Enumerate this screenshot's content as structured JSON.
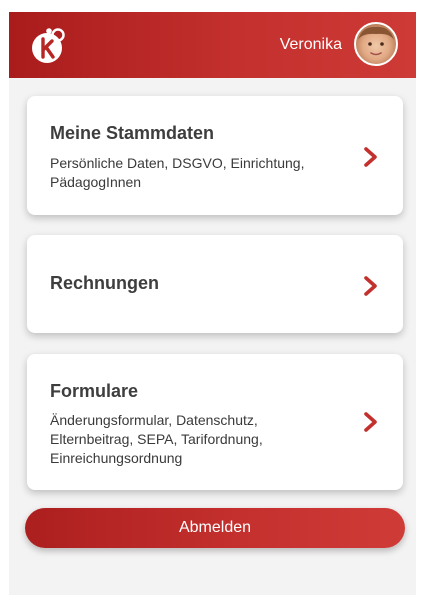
{
  "header": {
    "user_name": "Veronika",
    "logo_icon": "kita-logo-icon",
    "avatar_icon": "user-avatar",
    "colors": {
      "header_start": "#a91c1c",
      "header_end": "#ce3a36"
    }
  },
  "cards": [
    {
      "title": "Meine Stammdaten",
      "subtitle": "Persönliche Daten, DSGVO, Einrichtung, PädagogInnen",
      "icon": "chevron-right-icon"
    },
    {
      "title": "Rechnungen",
      "icon": "chevron-right-icon"
    },
    {
      "title": "Formulare",
      "subtitle": "Änderungsformular, Datenschutz, Elternbeitrag, SEPA, Tarifordnung, Einreichungsordnung",
      "icon": "chevron-right-icon"
    }
  ],
  "actions": {
    "logout_label": "Abmelden"
  },
  "colors": {
    "accent": "#c3302d",
    "background": "#f4f3f3",
    "card": "#ffffff",
    "text": "#3e3e3e"
  }
}
